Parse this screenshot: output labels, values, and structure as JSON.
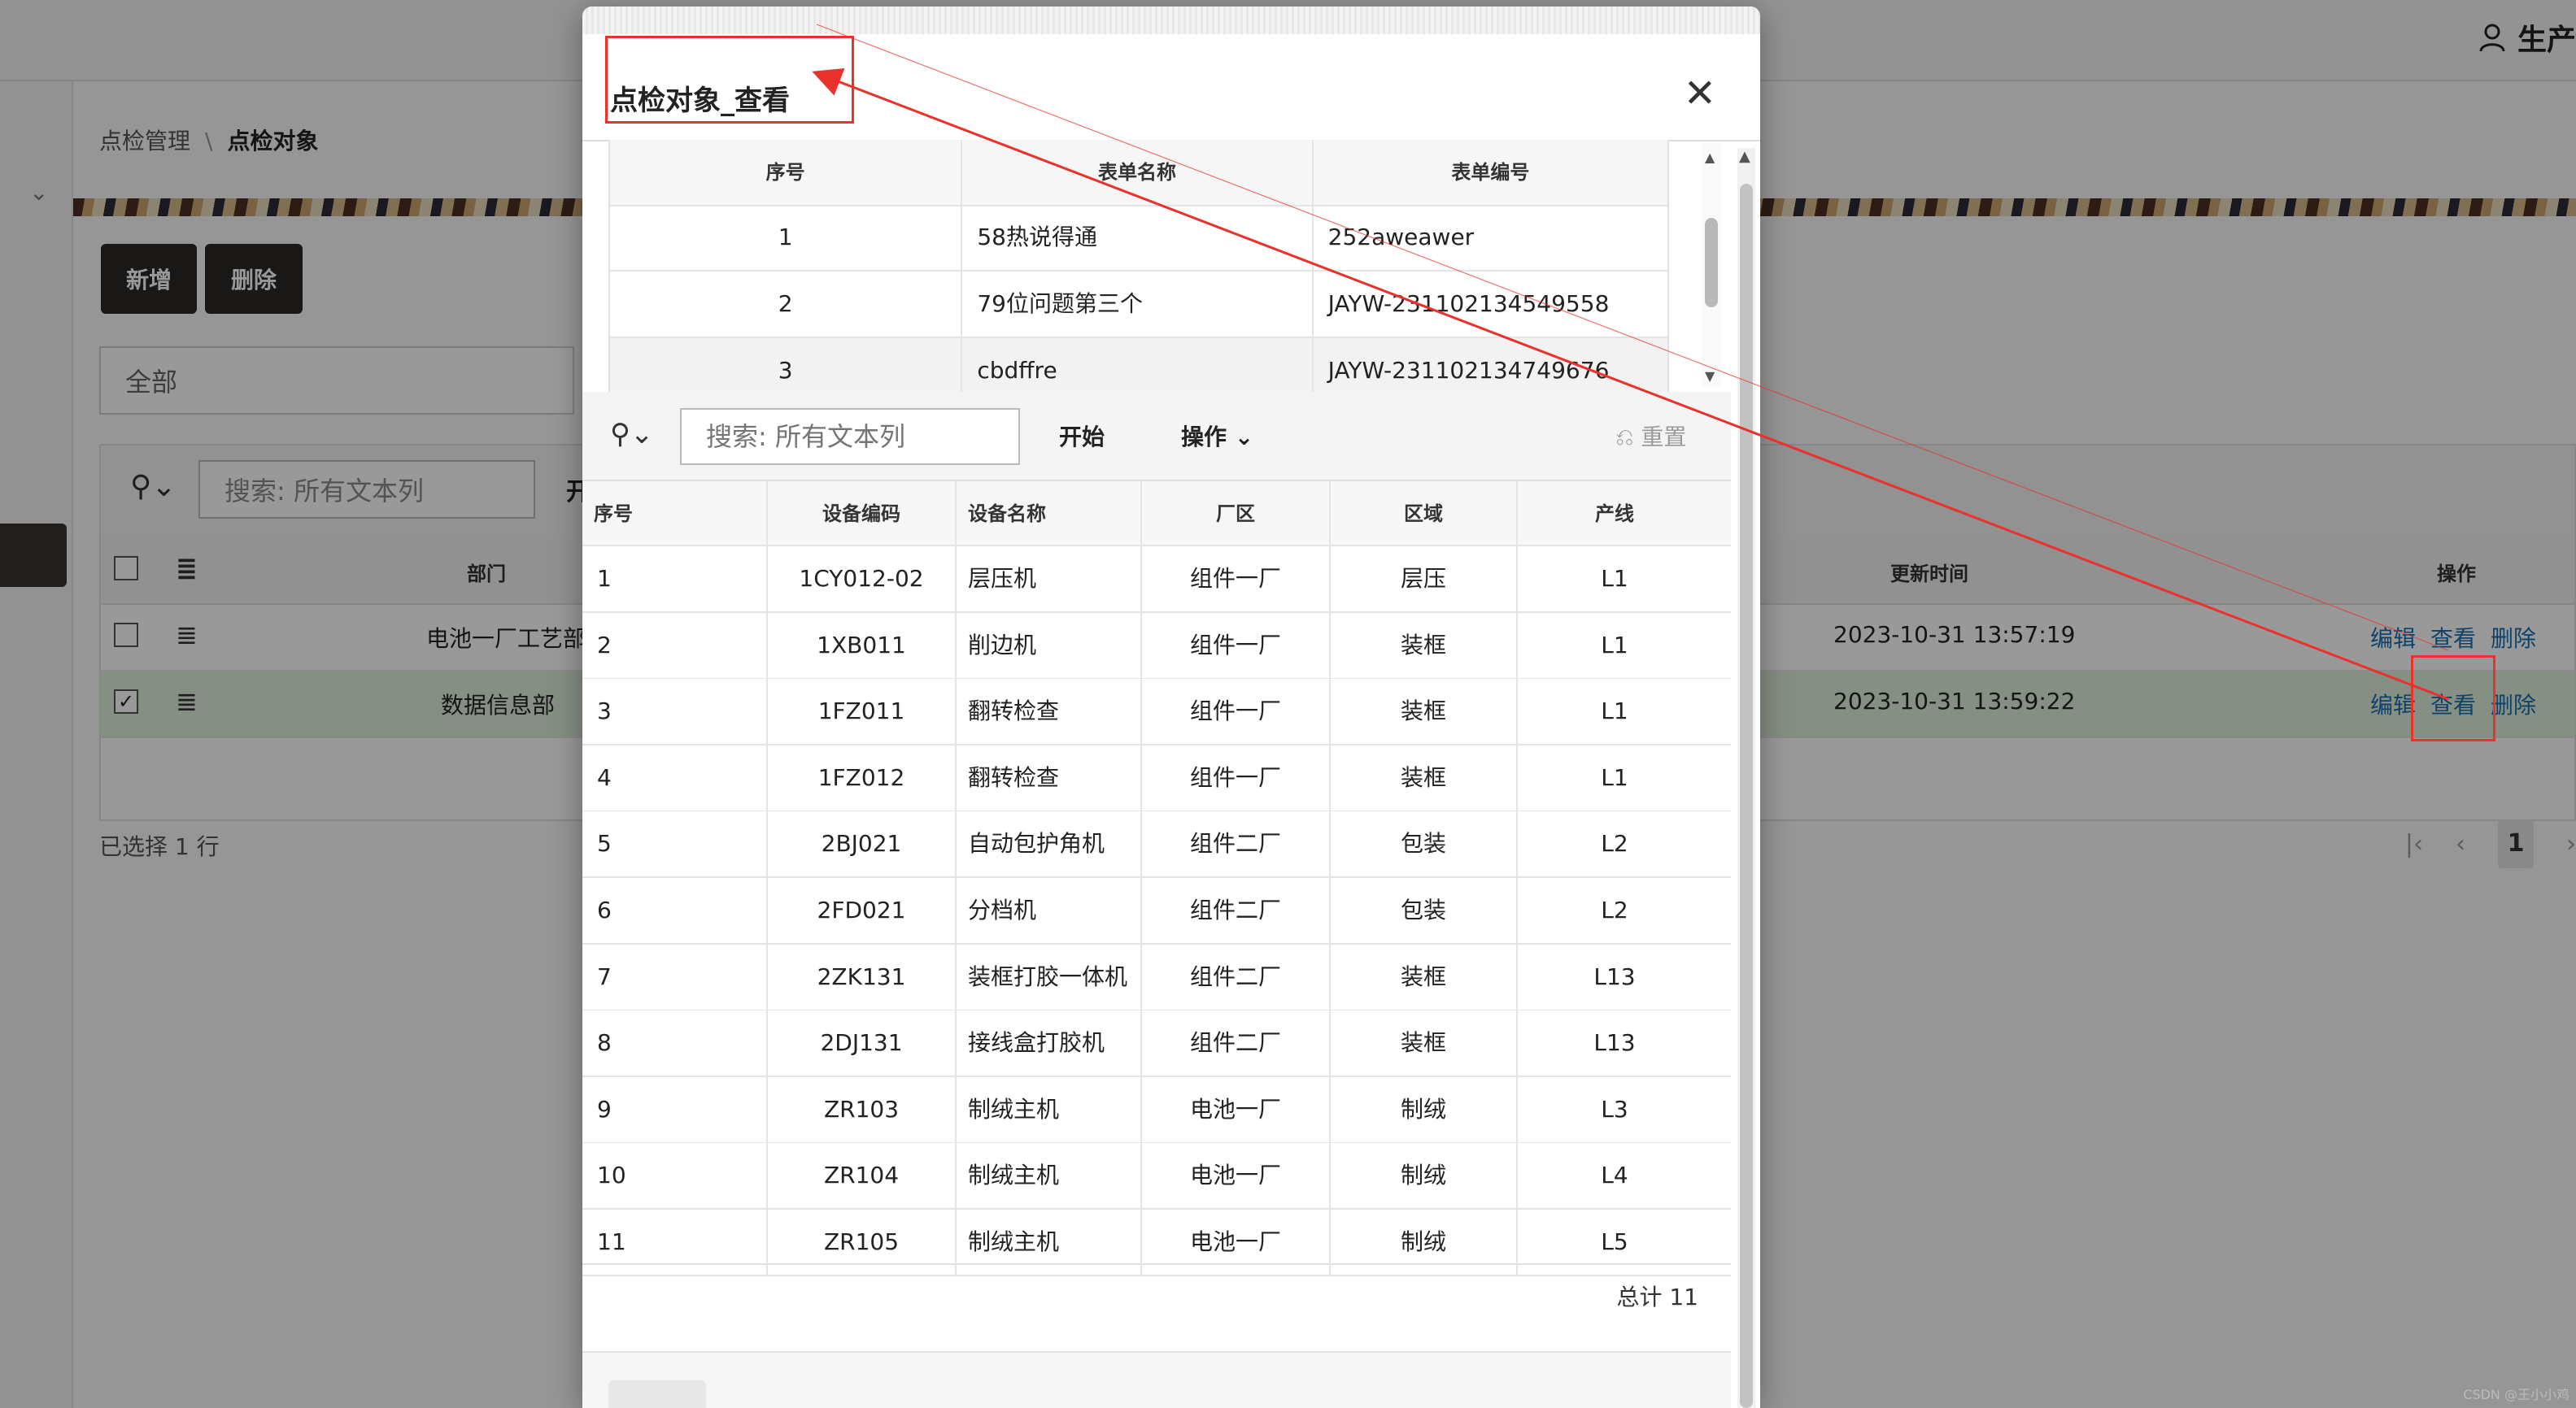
{
  "header": {
    "user_label": "生产"
  },
  "breadcrumb": {
    "parent": "点检管理",
    "separator": "\\",
    "current": "点检对象"
  },
  "actions": {
    "add_label": "新增",
    "delete_label": "删除"
  },
  "filter": {
    "select_value": "全部"
  },
  "bg_grid": {
    "search_placeholder": "搜索: 所有文本列",
    "start_label": "开",
    "columns": {
      "dept": "部门",
      "updated": "更新时间",
      "ops": "操作"
    },
    "rows": [
      {
        "dept": "电池一厂工艺部",
        "updated": "2023-10-31 13:57:19",
        "checked": false
      },
      {
        "dept": "数据信息部",
        "updated": "2023-10-31 13:59:22",
        "checked": true
      }
    ],
    "row_actions": {
      "edit": "编辑",
      "view": "查看",
      "delete": "删除"
    },
    "selected_text": "已选择 1 行",
    "page": "1"
  },
  "dialog": {
    "title": "点检对象_查看",
    "close_icon": "close-icon",
    "form_table": {
      "columns": [
        "序号",
        "表单名称",
        "表单编号"
      ],
      "rows": [
        [
          "1",
          "58热说得通",
          "252aweawer"
        ],
        [
          "2",
          "79位问题第三个",
          "JAYW-231102134549558"
        ],
        [
          "3",
          "cbdffre",
          "JAYW-231102134749676"
        ]
      ]
    },
    "toolbar": {
      "search_placeholder": "搜索: 所有文本列",
      "start_label": "开始",
      "ops_label": "操作",
      "reset_label": "重置"
    },
    "table": {
      "columns": [
        "序号",
        "设备编码",
        "设备名称",
        "厂区",
        "区域",
        "产线"
      ],
      "rows": [
        [
          "1",
          "1CY012-02",
          "层压机",
          "组件一厂",
          "层压",
          "L1"
        ],
        [
          "2",
          "1XB011",
          "削边机",
          "组件一厂",
          "装框",
          "L1"
        ],
        [
          "3",
          "1FZ011",
          "翻转检查",
          "组件一厂",
          "装框",
          "L1"
        ],
        [
          "4",
          "1FZ012",
          "翻转检查",
          "组件一厂",
          "装框",
          "L1"
        ],
        [
          "5",
          "2BJ021",
          "自动包护角机",
          "组件二厂",
          "包装",
          "L2"
        ],
        [
          "6",
          "2FD021",
          "分档机",
          "组件二厂",
          "包装",
          "L2"
        ],
        [
          "7",
          "2ZK131",
          "装框打胶一体机",
          "组件二厂",
          "装框",
          "L13"
        ],
        [
          "8",
          "2DJ131",
          "接线盒打胶机",
          "组件二厂",
          "装框",
          "L13"
        ],
        [
          "9",
          "ZR103",
          "制绒主机",
          "电池一厂",
          "制绒",
          "L3"
        ],
        [
          "10",
          "ZR104",
          "制绒主机",
          "电池一厂",
          "制绒",
          "L4"
        ],
        [
          "11",
          "ZR105",
          "制绒主机",
          "电池一厂",
          "制绒",
          "L5"
        ]
      ],
      "total": "总计 11"
    }
  },
  "watermark": "CSDN @王小小鸡",
  "colors": {
    "accent_link": "#1a6fb0",
    "annotation": "#e8322b",
    "dark_button": "#2c2825"
  }
}
